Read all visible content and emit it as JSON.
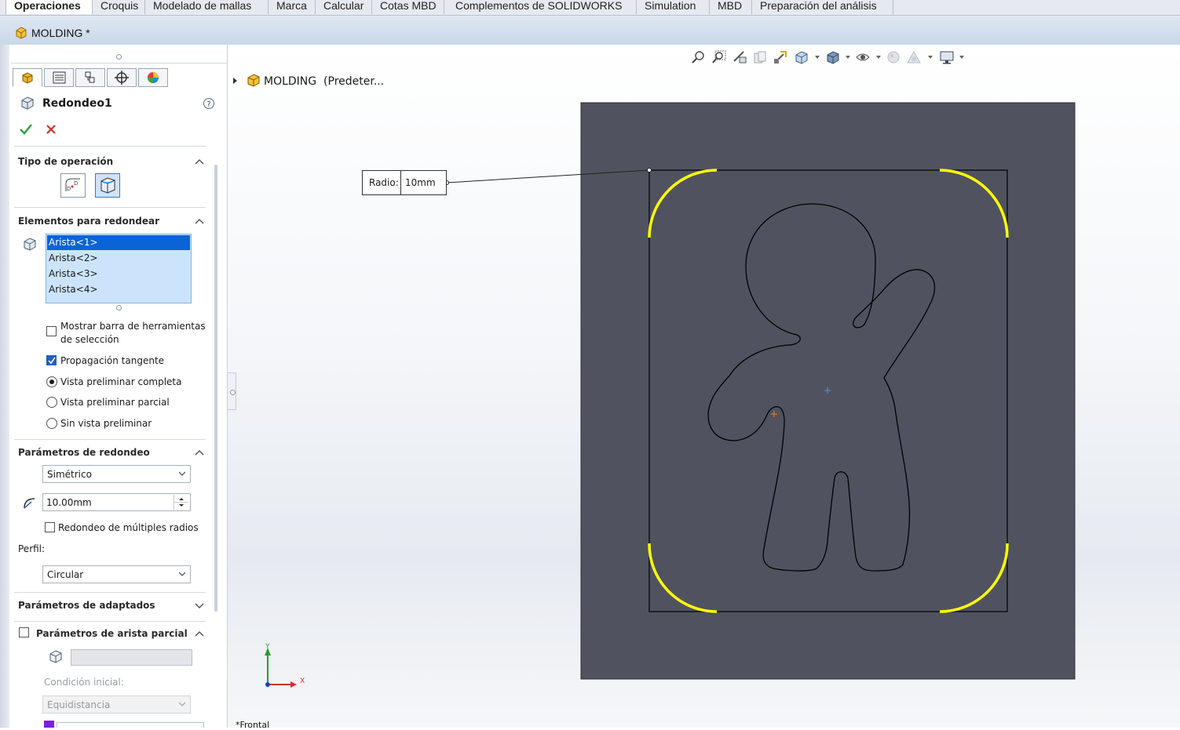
{
  "ribbon": {
    "tabs": [
      {
        "label": "Operaciones",
        "active": true
      },
      {
        "label": "Croquis"
      },
      {
        "label": "Modelado de mallas"
      },
      {
        "label": "Marca"
      },
      {
        "label": "Calcular"
      },
      {
        "label": "Cotas MBD"
      },
      {
        "label": "Complementos de SOLIDWORKS"
      },
      {
        "label": "Simulation"
      },
      {
        "label": "MBD"
      },
      {
        "label": "Preparación del análisis"
      }
    ]
  },
  "document": {
    "title": "MOLDING *"
  },
  "property_manager": {
    "feature_name": "Redondeo1",
    "sections": {
      "operation_type": {
        "title": "Tipo de operación"
      },
      "items_to_fillet": {
        "title": "Elementos para redondear",
        "edges": [
          "Arista<1>",
          "Arista<2>",
          "Arista<3>",
          "Arista<4>"
        ],
        "show_selection_toolbar": "Mostrar barra de herramientas de selección",
        "tangent_propagation": "Propagación tangente",
        "full_preview": "Vista preliminar completa",
        "partial_preview": "Vista preliminar parcial",
        "no_preview": "Sin vista preliminar"
      },
      "fillet_parameters": {
        "title": "Parámetros de redondeo",
        "method": "Simétrico",
        "radius": "10.00mm",
        "multi_radius": "Redondeo de múltiples radios",
        "profile_label": "Perfil:",
        "profile": "Circular"
      },
      "setback_parameters": {
        "title": "Parámetros de adaptados"
      },
      "partial_edge": {
        "title": "Parámetros de arista parcial",
        "start_condition_label": "Condición inicial:",
        "start_condition": "Equidistancia"
      }
    }
  },
  "graphics": {
    "tree_root": "MOLDING  (Predeter...",
    "callout_label": "Radio:",
    "callout_value": "10mm",
    "view_label": "*Frontal",
    "triad_x": "X",
    "triad_y": "Y",
    "colors": {
      "plate": "#50535f",
      "fillet_highlight": "#ffff00",
      "outline": "#000000"
    }
  }
}
